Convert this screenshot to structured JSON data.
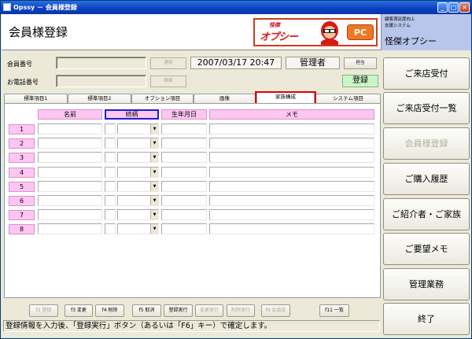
{
  "window": {
    "title": "Opssy － 会員様登録"
  },
  "header": {
    "page_title": "会員様登録",
    "logo_top": "怪傑",
    "logo_brand": "オプシー",
    "logo_pc": "PC",
    "sys_line1": "顧客満足度向上",
    "sys_line2": "支援システム",
    "sys_name": "怪傑オプシー"
  },
  "form": {
    "member_no_label": "会員番号",
    "phone_label": "お電話番号",
    "btn_select": "選択",
    "btn_search": "検索",
    "datetime": "2007/03/17 20:47",
    "staff_name": "管理者",
    "btn_staff": "担当",
    "mode_badge": "登録"
  },
  "tabs": [
    "標準項目1",
    "標準項目2",
    "オプション項目",
    "画像",
    "家族構成",
    "システム項目"
  ],
  "grid": {
    "headers": [
      "名前",
      "続柄",
      "生年月日",
      "メモ"
    ],
    "rows": [
      "1",
      "2",
      "3",
      "4",
      "5",
      "6",
      "7",
      "8"
    ]
  },
  "fkeys": [
    "f2 登録",
    "f3 変更",
    "f4 削除",
    "f5 取消",
    "登録実行",
    "変更実行",
    "削除実行",
    "f9 会員証",
    "f11 一覧"
  ],
  "status_message": "登録情報を入力後、「登録実行」ボタン（あるいは「F6」キー）で確定します。",
  "sidebar": [
    "ご来店受付",
    "ご来店受付一覧",
    "会員様登録",
    "ご購入履歴",
    "ご紹介者・ご家族",
    "ご要望メモ",
    "管理業務",
    "終了"
  ],
  "colors": {
    "title_bar": "#0a3fbf",
    "pink": "#ffc6f2",
    "highlight": "#e00000",
    "green_badge": "#c9f5c9"
  }
}
